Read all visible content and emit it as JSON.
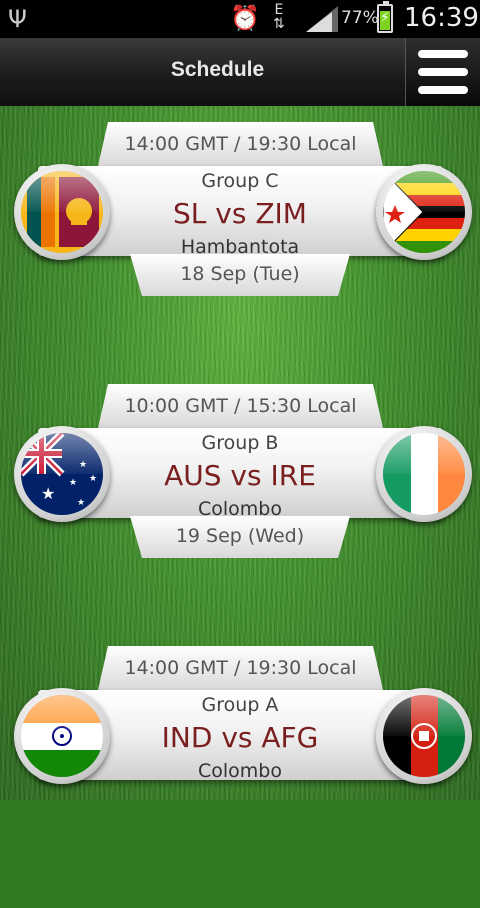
{
  "status_bar": {
    "usb_icon": "usb-icon",
    "alarm_icon": "alarm-icon",
    "network_label": "E",
    "battery_percent": "77%",
    "time": "16:39"
  },
  "header": {
    "title": "Schedule",
    "menu_icon": "hamburger-menu-icon"
  },
  "matches": [
    {
      "time": "14:00 GMT / 19:30 Local",
      "group": "Group C",
      "teams": "SL vs ZIM",
      "venue": "Hambantota",
      "date": "18 Sep (Tue)",
      "left_flag": "sri-lanka-flag-icon",
      "right_flag": "zimbabwe-flag-icon"
    },
    {
      "time": "10:00 GMT / 15:30 Local",
      "group": "Group B",
      "teams": "AUS vs IRE",
      "venue": "Colombo",
      "date": "19 Sep (Wed)",
      "left_flag": "australia-flag-icon",
      "right_flag": "ireland-flag-icon"
    },
    {
      "time": "14:00 GMT / 19:30 Local",
      "group": "Group A",
      "teams": "IND vs AFG",
      "venue": "Colombo",
      "date": "",
      "left_flag": "india-flag-icon",
      "right_flag": "afghanistan-flag-icon"
    }
  ],
  "colors": {
    "teams_text": "#7a1f1f",
    "grass": "#3f8f2a",
    "header_bg": "#1a1a1a"
  }
}
